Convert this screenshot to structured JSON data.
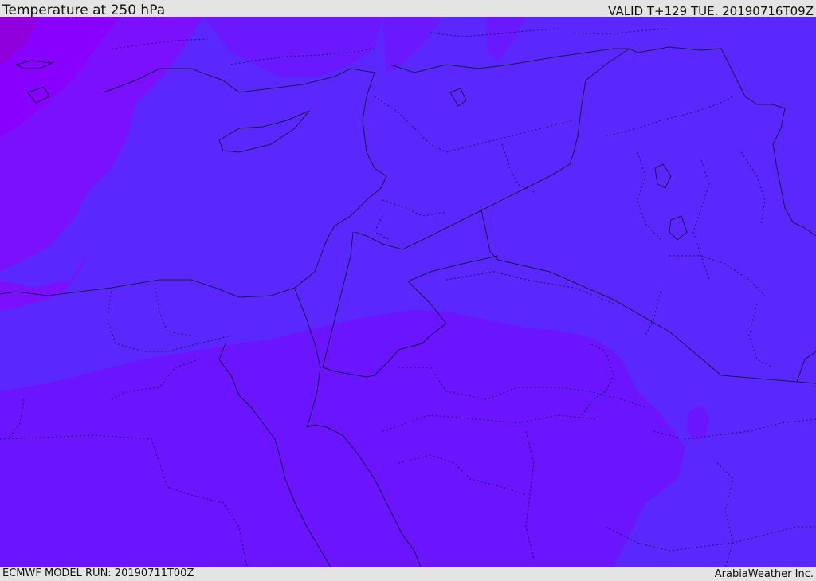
{
  "header": {
    "title": "Temperature at 250 hPa",
    "valid": "VALID T+129 TUE. 20190716T09Z"
  },
  "footer": {
    "model_run": "ECMWF MODEL RUN: 20190711T00Z",
    "credit": "ArabiaWeather Inc."
  },
  "map": {
    "field": "temperature",
    "level": "250 hPa",
    "colors": {
      "coldest": "#7a00e0",
      "cold": "#8000ff",
      "mid": "#5a28ff",
      "warm": "#6a14ff",
      "border": "#1a1a40"
    }
  }
}
